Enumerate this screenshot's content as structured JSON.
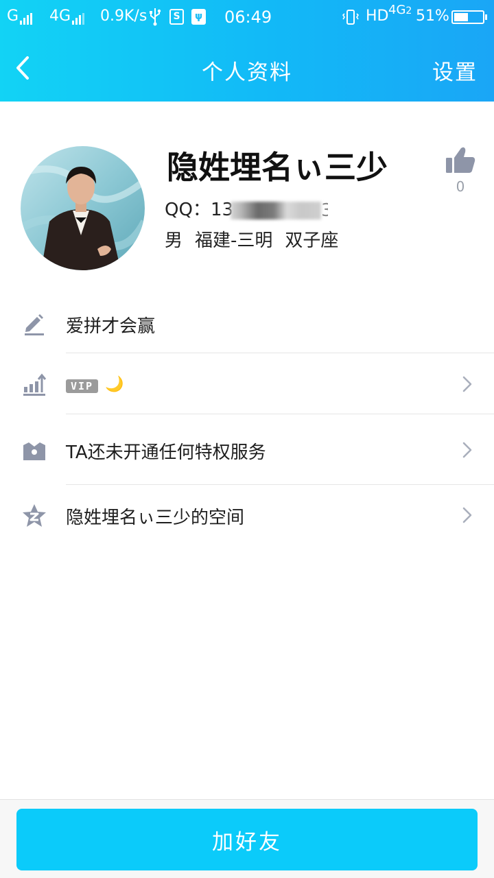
{
  "status_bar": {
    "carrier1": "G",
    "carrier2": "4G",
    "speed": "0.9K/s",
    "time": "06:49",
    "hd": "HD",
    "network": "4G",
    "network_sub": "2",
    "battery": "51%",
    "battery_level": 0.51
  },
  "header": {
    "title": "个人资料",
    "settings_label": "设置"
  },
  "profile": {
    "nickname": "隐姓埋名ぃ三少",
    "qq_label": "QQ：",
    "qq_visible_prefix": "13",
    "qq_visible_suffix": "3",
    "gender": "男",
    "location": "福建-三明",
    "zodiac": "双子座",
    "like_count": "0"
  },
  "rows": {
    "signature": "爱拼才会赢",
    "vip_badge": "VIP",
    "privilege": "TA还未开通任何特权服务",
    "space": "隐姓埋名ぃ三少的空间"
  },
  "bottom": {
    "add_friend_label": "加好友"
  },
  "colors": {
    "header_start": "#12d3f5",
    "header_end": "#1aa6f6",
    "button": "#0bcbfa",
    "icon_gray": "#8e95a8"
  },
  "icons": [
    "back-chevron-icon",
    "thumbs-up-icon",
    "edit-pencil-icon",
    "level-chart-icon",
    "crown-icon",
    "qzone-star-icon",
    "chevron-right-icon",
    "moon-icon"
  ]
}
